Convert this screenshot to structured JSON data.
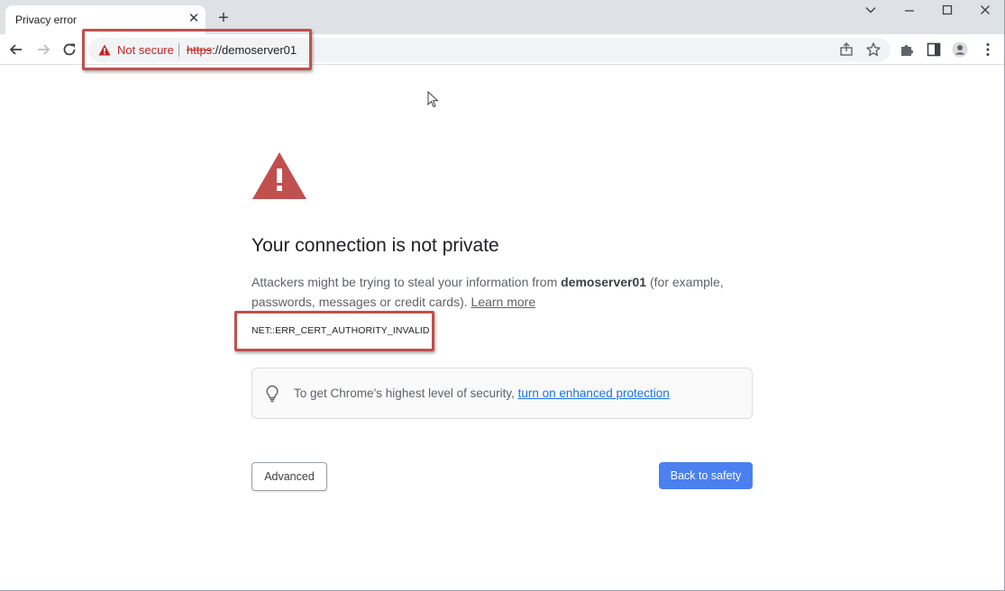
{
  "browser": {
    "tab_title": "Privacy error",
    "tab_close_glyph": "✕",
    "new_tab_glyph": "+",
    "window_controls": [
      "chevron-down-icon",
      "minimize-icon",
      "maximize-icon",
      "close-icon"
    ]
  },
  "toolbar": {
    "security_label": "Not secure",
    "url_scheme": "https",
    "url_rest": "://demoserver01",
    "icons": [
      "back-arrow-icon",
      "forward-arrow-icon",
      "reload-icon",
      "share-icon",
      "star-icon",
      "extensions-puzzle-icon",
      "side-panel-icon",
      "profile-avatar-icon",
      "kebab-menu-icon"
    ]
  },
  "interstitial": {
    "headline": "Your connection is not private",
    "body_prefix": "Attackers might be trying to steal your information from ",
    "body_host": "demoserver01",
    "body_suffix": " (for example, passwords, messages or credit cards). ",
    "learn_more": "Learn more",
    "error_code": "NET::ERR_CERT_AUTHORITY_INVALID",
    "promo_text": "To get Chrome’s highest level of security, ",
    "promo_link": "turn on enhanced protection",
    "advanced_button": "Advanced",
    "back_button": "Back to safety"
  },
  "colors": {
    "warning": "#c0504d",
    "link": "#1a73e8",
    "primary_button": "#4a80f0",
    "annotation_box": "#c0504d"
  }
}
